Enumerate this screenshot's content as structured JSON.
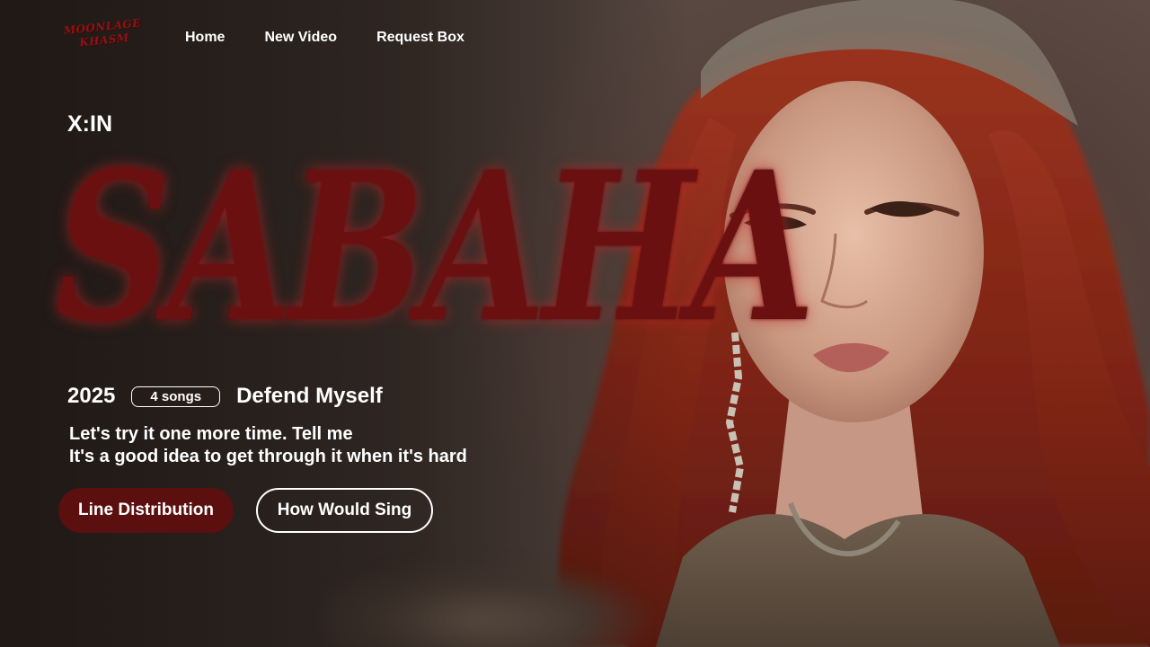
{
  "nav": {
    "logo_line1": "MOONLAGE",
    "logo_line2": "KHASM",
    "links": [
      "Home",
      "New Video",
      "Request Box"
    ]
  },
  "hero": {
    "artist": "X:IN",
    "title": "SABAHA",
    "year": "2025",
    "songs_badge": "4 songs",
    "album": "Defend Myself",
    "lyric_line1": "Let's try it one more time. Tell me",
    "lyric_line2": "It's a good idea to get through it when it's hard",
    "primary_button": "Line Distribution",
    "secondary_button": "How Would Sing"
  },
  "colors": {
    "accent": "#5b0f0f",
    "title_red": "#6b1010",
    "hair": "#8a2a1c"
  }
}
